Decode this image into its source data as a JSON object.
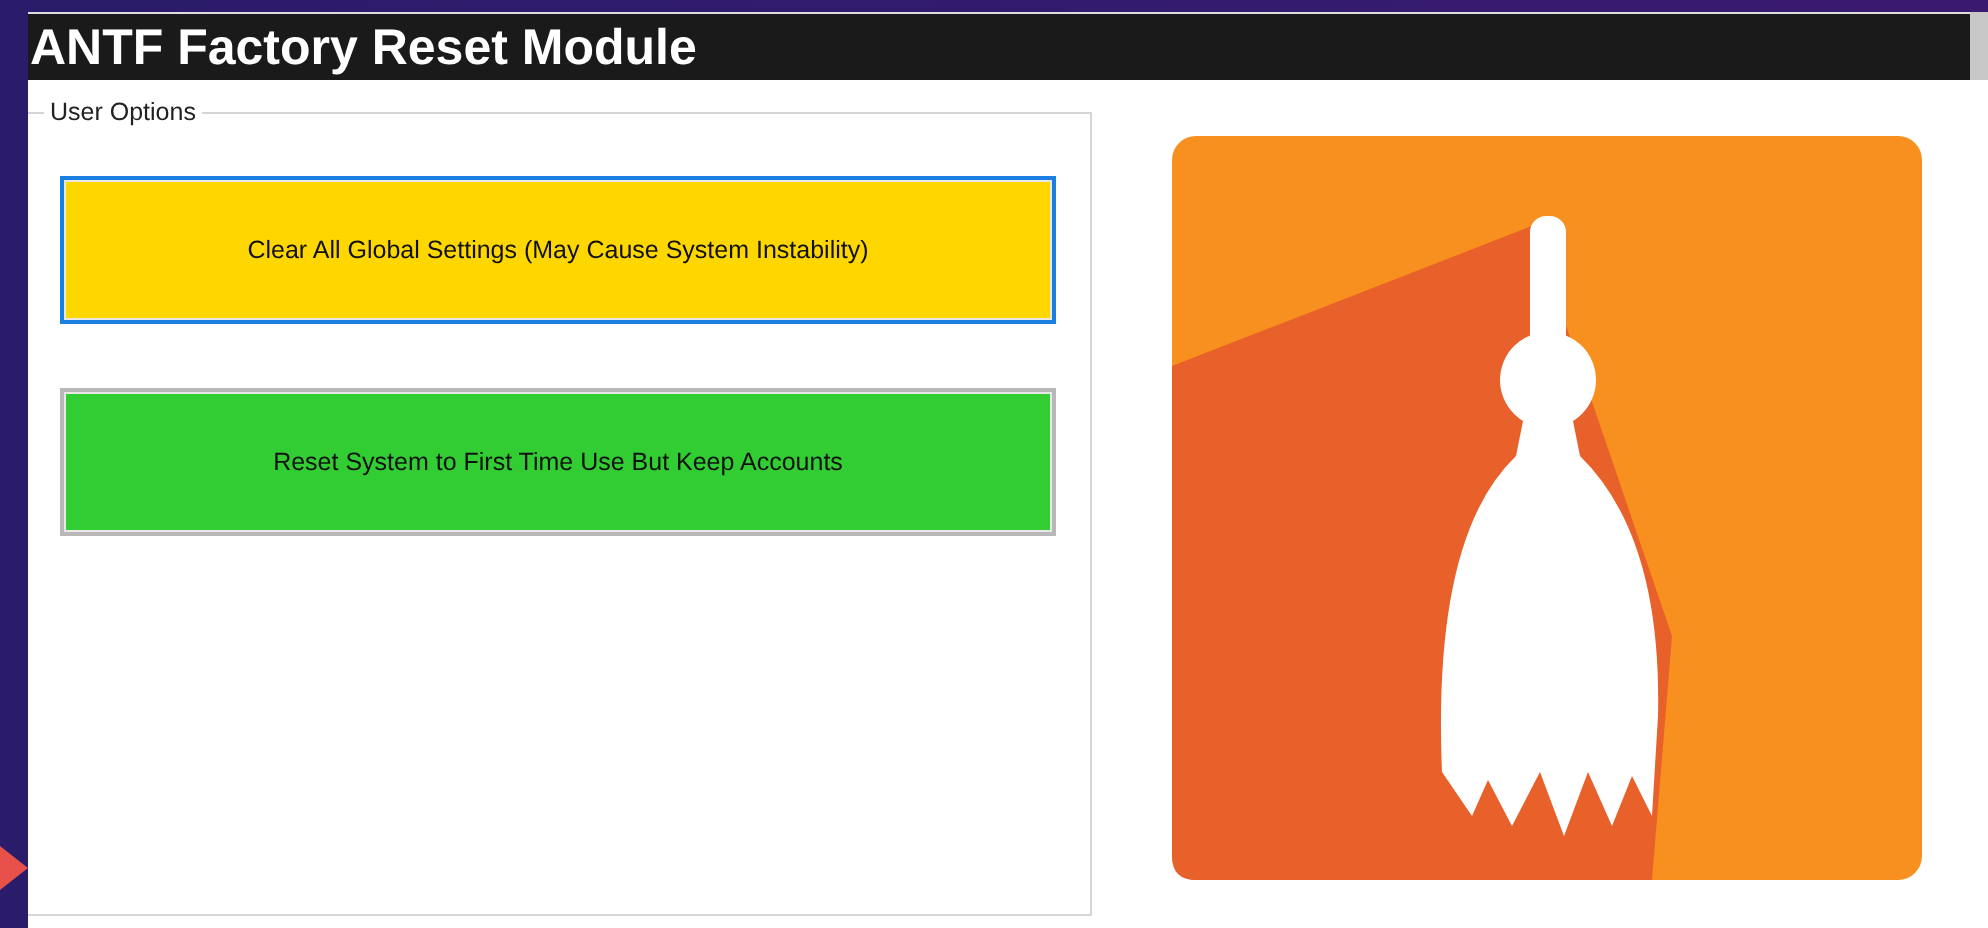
{
  "window": {
    "title": "ANTF Factory Reset Module"
  },
  "group": {
    "label": "User Options"
  },
  "buttons": [
    {
      "label": "Clear All Global Settings (May Cause System Instability)",
      "color": "#ffd700",
      "focused": true
    },
    {
      "label": "Reset System to First Time Use But Keep Accounts",
      "color": "#32cd32",
      "focused": false
    }
  ]
}
